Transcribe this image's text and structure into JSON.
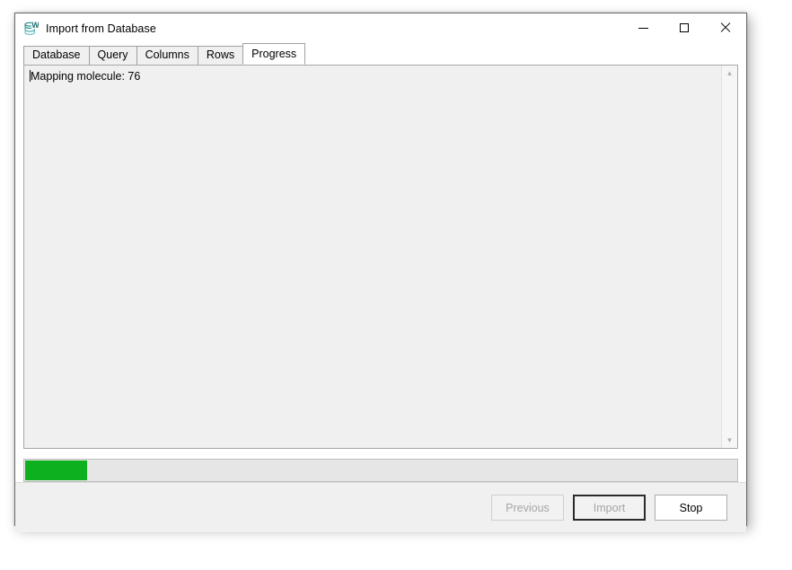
{
  "window": {
    "title": "Import from Database",
    "icon": "database-stack-icon",
    "controls": {
      "minimize": "minimize-icon",
      "maximize": "maximize-icon",
      "close": "close-icon"
    }
  },
  "tabs": [
    {
      "label": "Database",
      "selected": false
    },
    {
      "label": "Query",
      "selected": false
    },
    {
      "label": "Columns",
      "selected": false
    },
    {
      "label": "Rows",
      "selected": false
    },
    {
      "label": "Progress",
      "selected": true
    }
  ],
  "log": {
    "text": "Mapping molecule: 76",
    "scrollbar": {
      "up_arrow": "▲",
      "down_arrow": "▼"
    }
  },
  "progress": {
    "percent": 8.7,
    "fill_color": "#0db01f",
    "track_color": "#e6e6e6"
  },
  "footer": {
    "buttons": [
      {
        "label": "Previous",
        "disabled": true,
        "default": false
      },
      {
        "label": "Import",
        "disabled": true,
        "default": true
      },
      {
        "label": "Stop",
        "disabled": false,
        "default": false
      }
    ]
  },
  "colors": {
    "accent_green": "#0db01f",
    "window_bg": "#f0f0f0",
    "title_bg": "#ffffff",
    "border": "#6a6a6a",
    "icon_teal": "#1f8a8a"
  }
}
